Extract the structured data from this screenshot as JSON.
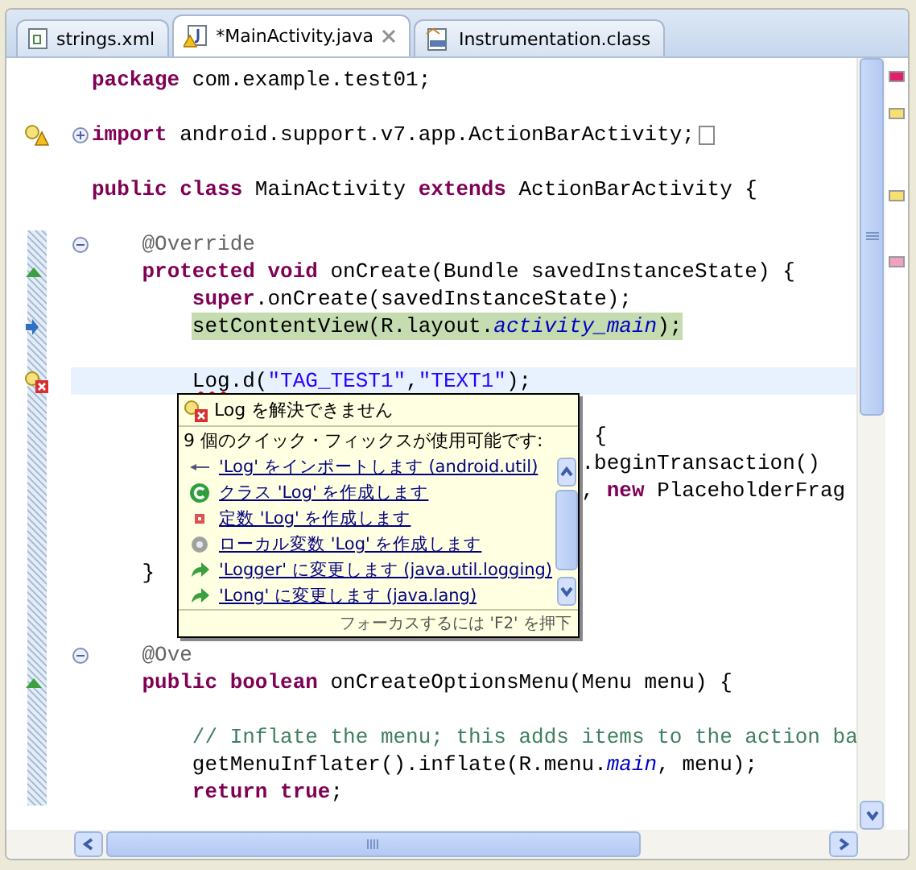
{
  "tabs": [
    {
      "kind": "xml",
      "label": "strings.xml",
      "selected": false
    },
    {
      "kind": "java",
      "label": "*MainActivity.java",
      "selected": true
    },
    {
      "kind": "class",
      "label": "Instrumentation.class",
      "selected": false
    }
  ],
  "code_lines": [
    {
      "changed": false,
      "tokens": [
        {
          "kind": "keyword",
          "text": "package"
        },
        {
          "kind": "plain",
          "text": " com.example.test01;"
        }
      ]
    },
    {
      "changed": false
    },
    {
      "changed": false,
      "marker": {
        "kind": "warning-bulb"
      },
      "fold": {
        "kind": "expand"
      },
      "tokens": [
        {
          "kind": "keyword",
          "text": "import"
        },
        {
          "kind": "plain",
          "text": " android.support.v7.app.ActionBarActivity;"
        }
      ]
    },
    {
      "changed": false
    },
    {
      "changed": false,
      "tokens": [
        {
          "kind": "keyword",
          "text": "public class"
        },
        {
          "kind": "plain",
          "text": " MainActivity "
        },
        {
          "kind": "keyword",
          "text": "extends"
        },
        {
          "kind": "plain",
          "text": " ActionBarActivity {"
        }
      ]
    },
    {
      "changed": false
    },
    {
      "changed": true,
      "fold": {
        "kind": "collapse"
      },
      "tokens": [
        {
          "kind": "annotation",
          "text": "    @Override"
        }
      ]
    },
    {
      "changed": true,
      "marker": {
        "kind": "override"
      },
      "tokens": [
        {
          "kind": "keyword",
          "text": "    protected void"
        },
        {
          "kind": "plain",
          "text": " onCreate(Bundle savedInstanceState) {"
        }
      ]
    },
    {
      "changed": true,
      "tokens": [
        {
          "kind": "keyword",
          "text": "        super"
        },
        {
          "kind": "plain",
          "text": ".onCreate(savedInstanceState);"
        }
      ]
    },
    {
      "changed": true,
      "highlighted": true,
      "marker": {
        "kind": "arrow"
      },
      "tokens": [
        {
          "kind": "plain",
          "text": "        setContentView(R.layout."
        },
        {
          "kind": "field",
          "text": "activity_main"
        },
        {
          "kind": "plain",
          "text": ");"
        }
      ]
    },
    {
      "changed": true
    },
    {
      "changed": true,
      "current": true,
      "marker": {
        "kind": "error-bulb"
      },
      "tokens": [
        {
          "kind": "error",
          "text": "        Log"
        },
        {
          "kind": "plain",
          "text": ".d("
        },
        {
          "kind": "string",
          "text": "\"TAG_TEST1\""
        },
        {
          "kind": "plain",
          "text": ","
        },
        {
          "kind": "string",
          "text": "\"TEXT1\""
        },
        {
          "kind": "plain",
          "text": ");"
        }
      ]
    },
    {
      "changed": true
    },
    {
      "changed": true,
      "tokens": [
        {
          "kind": "plain",
          "text": "                                        {"
        }
      ]
    },
    {
      "changed": true,
      "tokens": [
        {
          "kind": "plain",
          "text": "                                       .beginTransaction()"
        }
      ]
    },
    {
      "changed": true,
      "tokens": [
        {
          "kind": "plain",
          "text": "                                       , "
        },
        {
          "kind": "keyword",
          "text": "new"
        },
        {
          "kind": "plain",
          "text": " PlaceholderFrag"
        }
      ]
    },
    {
      "changed": true
    },
    {
      "changed": true
    },
    {
      "changed": true,
      "tokens": [
        {
          "kind": "plain",
          "text": "    }"
        }
      ]
    },
    {
      "changed": true
    },
    {
      "changed": true
    },
    {
      "changed": true,
      "fold": {
        "kind": "collapse"
      },
      "tokens": [
        {
          "kind": "annotation",
          "text": "    @Ove"
        }
      ]
    },
    {
      "changed": true,
      "marker": {
        "kind": "override"
      },
      "tokens": [
        {
          "kind": "keyword",
          "text": "    public boolean"
        },
        {
          "kind": "plain",
          "text": " onCreateOptionsMenu(Menu menu) {"
        }
      ]
    },
    {
      "changed": true
    },
    {
      "changed": true,
      "tokens": [
        {
          "kind": "comment",
          "text": "        // Inflate the menu; this adds items to the action ba"
        }
      ]
    },
    {
      "changed": true,
      "tokens": [
        {
          "kind": "plain",
          "text": "        getMenuInflater().inflate(R.menu."
        },
        {
          "kind": "field",
          "text": "main"
        },
        {
          "kind": "plain",
          "text": ", menu);"
        }
      ]
    },
    {
      "changed": true,
      "tokens": [
        {
          "kind": "keyword",
          "text": "        return true"
        },
        {
          "kind": "plain",
          "text": ";"
        }
      ]
    }
  ],
  "quick_fix": {
    "title": "Log を解決できません",
    "summary": "9 個のクイック・フィックスが使用可能です:",
    "proposals": [
      {
        "kind": "import",
        "label": "'Log' をインポートします (android.util)"
      },
      {
        "kind": "class",
        "label": "クラス 'Log' を作成します"
      },
      {
        "kind": "constant",
        "label": "定数 'Log' を作成します"
      },
      {
        "kind": "local",
        "label": "ローカル変数 'Log' を作成します"
      },
      {
        "kind": "change",
        "label": "'Logger' に変更します (java.util.logging)"
      },
      {
        "kind": "change",
        "label": "'Long' に変更します (java.lang)"
      }
    ],
    "footer": "フォーカスするには 'F2' を押下"
  }
}
